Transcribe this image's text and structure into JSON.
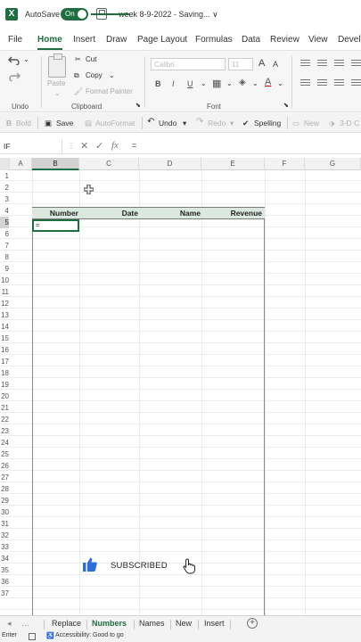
{
  "titlebar": {
    "app_icon_letter": "X",
    "autosave_label": "AutoSave",
    "autosave_state": "On",
    "doc_title": "week 8-9-2022 - Saving...",
    "chevron": "∨",
    "accent_color": "#1e6e42"
  },
  "tabs": [
    "File",
    "Home",
    "Insert",
    "Draw",
    "Page Layout",
    "Formulas",
    "Data",
    "Review",
    "View",
    "Develo"
  ],
  "active_tab": "Home",
  "ribbon": {
    "undo_group": "Undo",
    "clipboard_group": "Clipboard",
    "font_group": "Font",
    "paste": "Paste",
    "cut": "Cut",
    "copy": "Copy",
    "format_painter": "Format Painter",
    "font_name": "Calibri",
    "font_size": "11",
    "grow_font": "A",
    "shrink_font": "A",
    "bold": "B",
    "italic": "I",
    "underline": "U"
  },
  "qat": {
    "bold": "Bold",
    "save": "Save",
    "autoformat": "AutoFormat",
    "undo": "Undo",
    "redo": "Redo",
    "spelling": "Spelling",
    "new": "New",
    "three_d": "3-D C"
  },
  "formula_bar": {
    "name_box": "IF",
    "cancel": "✕",
    "enter": "✓",
    "fx": "fx",
    "content": "="
  },
  "columns": [
    "A",
    "B",
    "C",
    "D",
    "E",
    "F",
    "G"
  ],
  "rows": [
    "1",
    "2",
    "3",
    "4",
    "5",
    "6",
    "7",
    "8",
    "9",
    "10",
    "11",
    "12",
    "13",
    "14",
    "15",
    "16",
    "17",
    "18",
    "19",
    "20",
    "21",
    "22",
    "23",
    "24",
    "25",
    "26",
    "27",
    "28",
    "29",
    "30",
    "31",
    "32",
    "33",
    "34",
    "35",
    "36",
    "37"
  ],
  "table": {
    "headers": [
      "Number",
      "Date",
      "Name",
      "Revenue"
    ],
    "active_cell_value": "="
  },
  "overlay": {
    "subscribed_text": "SUBSCRIBED",
    "like_color": "#2d6fd8"
  },
  "sheet_tabs": [
    "Replace",
    "Numbers",
    "Names",
    "New",
    "Insert"
  ],
  "active_sheet": "Numbers",
  "status": {
    "mode": "Enter",
    "accessibility": "Accessibility: Good to go"
  }
}
